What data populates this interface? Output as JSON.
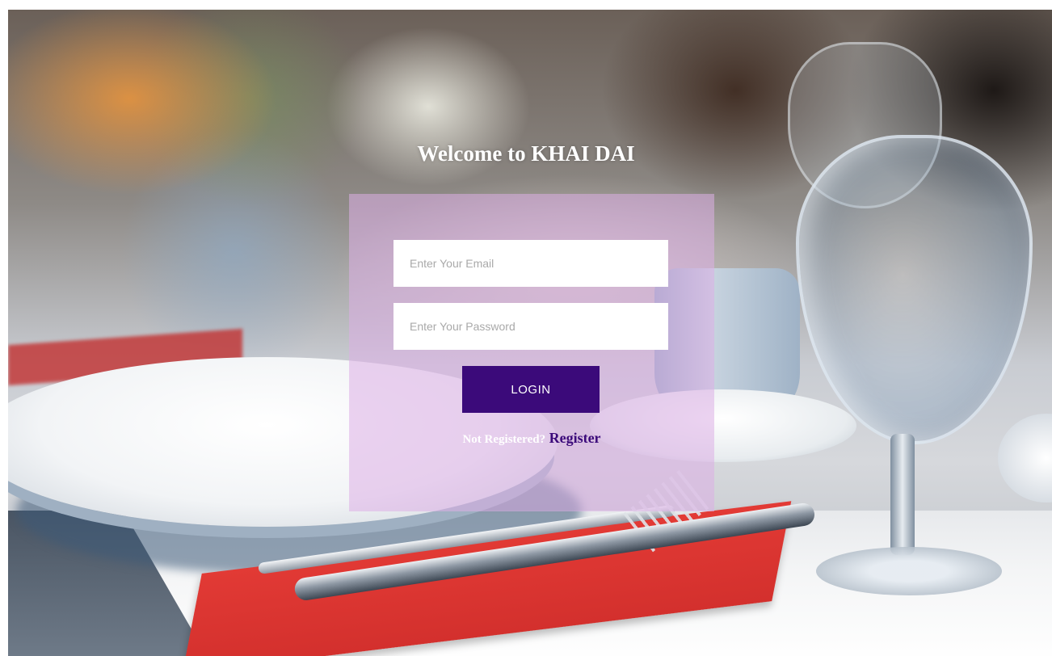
{
  "page": {
    "welcome_title": "Welcome to KHAI DAI"
  },
  "login_form": {
    "email_placeholder": "Enter Your Email",
    "email_value": "",
    "password_placeholder": "Enter Your Password",
    "password_value": "",
    "login_label": "LOGIN",
    "not_registered_text": "Not Registered?",
    "register_link_label": "Register"
  },
  "colors": {
    "panel_overlay": "#dcafe6",
    "login_button_bg": "#3b0a7a",
    "register_link": "#3b0a7a"
  }
}
